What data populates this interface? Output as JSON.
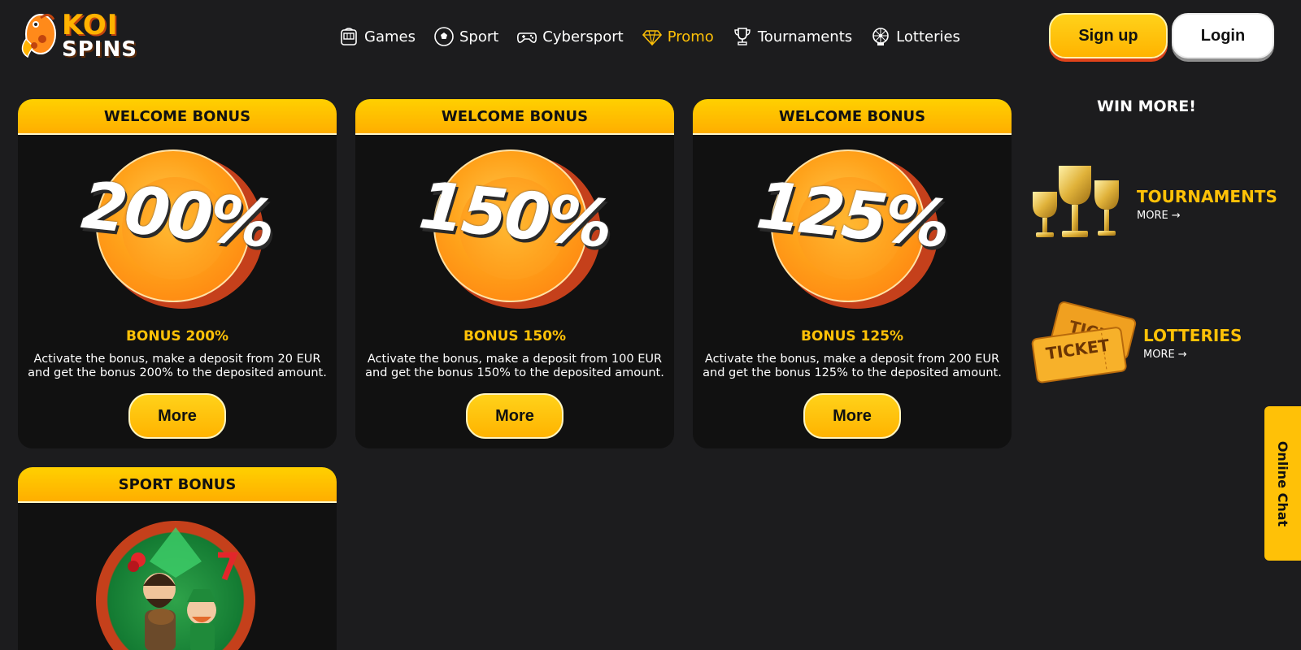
{
  "brand": {
    "top": "KOI",
    "bottom": "SPINS"
  },
  "nav": {
    "items": [
      {
        "label": "Games",
        "icon": "slot-machine-icon"
      },
      {
        "label": "Sport",
        "icon": "soccer-ball-icon"
      },
      {
        "label": "Cybersport",
        "icon": "gamepad-icon"
      },
      {
        "label": "Promo",
        "icon": "diamond-icon",
        "active": true
      },
      {
        "label": "Tournaments",
        "icon": "trophy-icon"
      },
      {
        "label": "Lotteries",
        "icon": "lottery-wheel-icon"
      }
    ]
  },
  "auth": {
    "signup": "Sign up",
    "login": "Login"
  },
  "cards": [
    {
      "header": "WELCOME BONUS",
      "percent": "200%",
      "title": "BONUS 200%",
      "desc_line1": "Activate the bonus, make a deposit from 20 EUR",
      "desc_line2": "and get the bonus 200% to the deposited amount.",
      "button": "More"
    },
    {
      "header": "WELCOME BONUS",
      "percent": "150%",
      "title": "BONUS 150%",
      "desc_line1": "Activate the bonus, make a deposit from 100 EUR",
      "desc_line2": "and get the bonus 150% to the deposited amount.",
      "button": "More"
    },
    {
      "header": "WELCOME BONUS",
      "percent": "125%",
      "title": "BONUS 125%",
      "desc_line1": "Activate the bonus, make a deposit from 200 EUR",
      "desc_line2": "and get the bonus 125% to the deposited amount.",
      "button": "More"
    }
  ],
  "sport_card": {
    "header": "SPORT BONUS"
  },
  "sidebar": {
    "title": "WIN MORE!",
    "tournaments": {
      "label": "TOURNAMENTS",
      "more": "MORE"
    },
    "lotteries": {
      "label": "LOTTERIES",
      "more": "MORE",
      "ticket_text": "TICKET"
    }
  },
  "chat": {
    "label": "Online Chat"
  },
  "colors": {
    "accent": "#ffc107",
    "background": "#1c1c1e",
    "card": "#111111",
    "coin": "#ff9a1a"
  }
}
